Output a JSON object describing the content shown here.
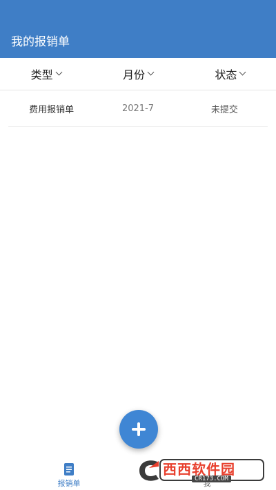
{
  "header": {
    "title": "我的报销单"
  },
  "filters": [
    {
      "label": "类型"
    },
    {
      "label": "月份"
    },
    {
      "label": "状态"
    }
  ],
  "list": [
    {
      "type": "费用报销单",
      "month": "2021-7",
      "status": "未提交"
    }
  ],
  "nav": {
    "items": [
      {
        "label": "报销单",
        "icon": "document-icon",
        "active": true
      },
      {
        "label": "我",
        "icon": "",
        "active": false
      }
    ]
  },
  "watermark": {
    "text": "西西软件园",
    "sub": "CR173.COM"
  },
  "colors": {
    "primary": "#3f7ec6",
    "fab": "#3f86d4",
    "watermark": "#e8402e"
  }
}
